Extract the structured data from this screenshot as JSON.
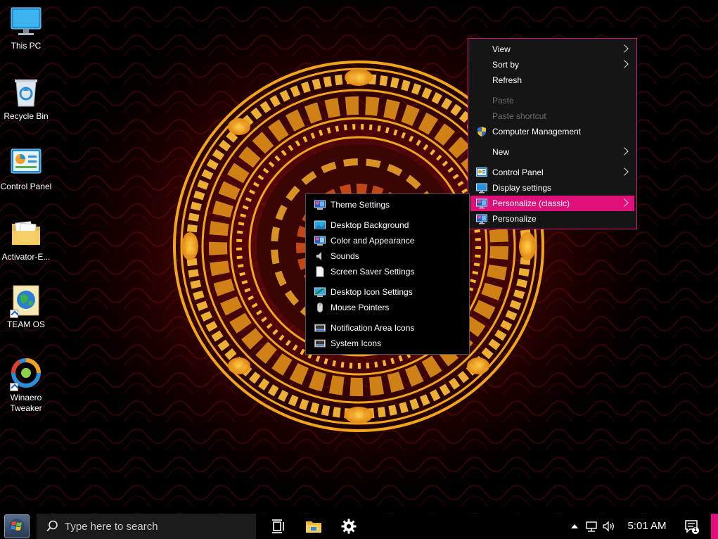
{
  "desktop": {
    "icons": [
      {
        "label": "This PC",
        "icon": "computer-icon"
      },
      {
        "label": "Recycle Bin",
        "icon": "recycle-bin-icon"
      },
      {
        "label": "Control Panel",
        "icon": "control-panel-icon"
      },
      {
        "label": "Activator-E...",
        "icon": "folder-icon"
      },
      {
        "label": "TEAM OS",
        "icon": "globe-shortcut-icon"
      },
      {
        "label": "Winaero Tweaker",
        "icon": "winaero-tweaker-icon"
      }
    ]
  },
  "context_menu": {
    "items": [
      {
        "label": "View",
        "submenu": true
      },
      {
        "label": "Sort by",
        "submenu": true
      },
      {
        "label": "Refresh"
      },
      {
        "label": "Paste",
        "disabled": true
      },
      {
        "label": "Paste shortcut",
        "disabled": true
      },
      {
        "label": "Computer Management",
        "icon": "uac-shield-icon"
      },
      {
        "label": "New",
        "submenu": true
      },
      {
        "label": "Control Panel",
        "icon": "control-panel-icon",
        "submenu": true
      },
      {
        "label": "Display settings",
        "icon": "monitor-icon"
      },
      {
        "label": "Personalize (classic)",
        "icon": "personalize-icon",
        "submenu": true,
        "highlighted": true
      },
      {
        "label": "Personalize",
        "icon": "personalize-icon"
      }
    ]
  },
  "submenu": {
    "items": [
      {
        "label": "Theme Settings",
        "icon": "personalize-icon"
      },
      {
        "label": "Desktop Background",
        "icon": "desktop-background-icon"
      },
      {
        "label": "Color and Appearance",
        "icon": "color-appearance-icon"
      },
      {
        "label": "Sounds",
        "icon": "speaker-icon"
      },
      {
        "label": "Screen Saver Settings",
        "icon": "document-icon"
      },
      {
        "label": "Desktop Icon Settings",
        "icon": "desktop-icon-settings-icon"
      },
      {
        "label": "Mouse Pointers",
        "icon": "mouse-icon"
      },
      {
        "label": "Notification Area Icons",
        "icon": "notification-area-icon"
      },
      {
        "label": "System Icons",
        "icon": "system-icons-icon"
      }
    ]
  },
  "taskbar": {
    "search_placeholder": "Type here to search",
    "clock": "5:01 AM",
    "notification_count": "1",
    "accent_color": "#e0107a"
  }
}
